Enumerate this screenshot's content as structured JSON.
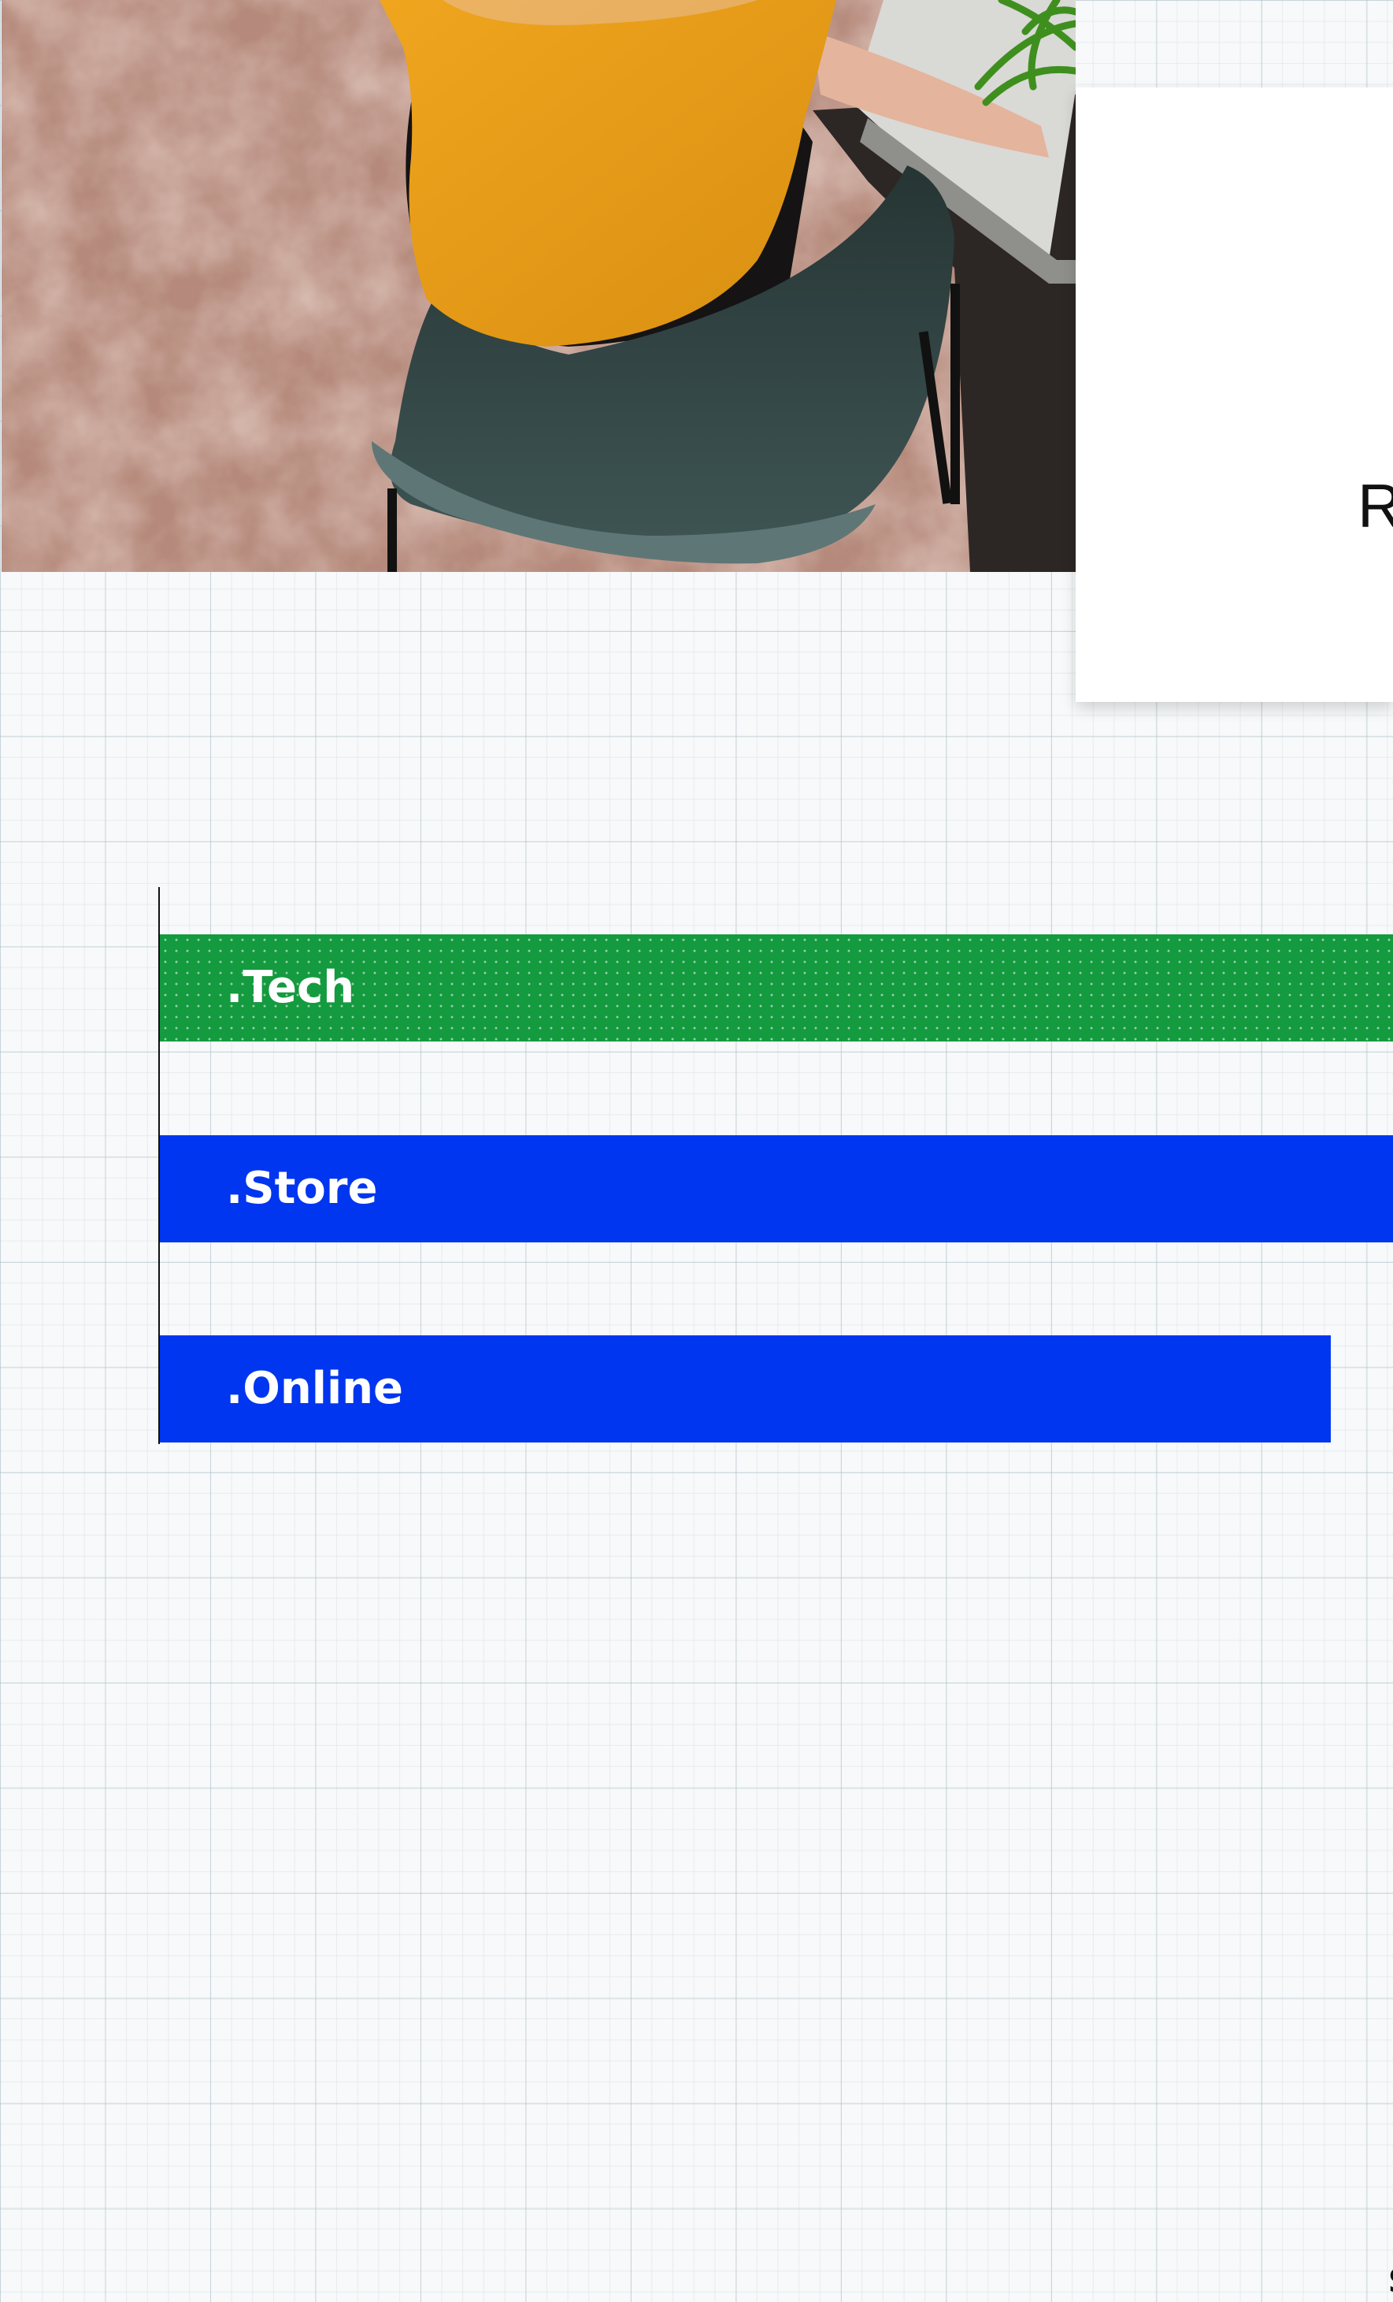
{
  "hero": {
    "image": "person-at-desk-photo"
  },
  "card": {
    "text": "R"
  },
  "chart_data": {
    "type": "bar",
    "orientation": "horizontal",
    "categories": [
      ".Tech",
      ".Store",
      ".Online"
    ],
    "values": [
      null,
      null,
      null
    ],
    "bar_colors": [
      "#149a3f",
      "#0036ef",
      "#0036ef"
    ],
    "bar_patterns": [
      "dotted",
      "solid",
      "solid"
    ],
    "grid": true,
    "value_labels_partial": [
      "",
      "",
      "$"
    ]
  },
  "colors": {
    "tech_bar": "#149a3f",
    "blue_bar": "#0036ef",
    "grid_background": "#f7f9fa"
  }
}
